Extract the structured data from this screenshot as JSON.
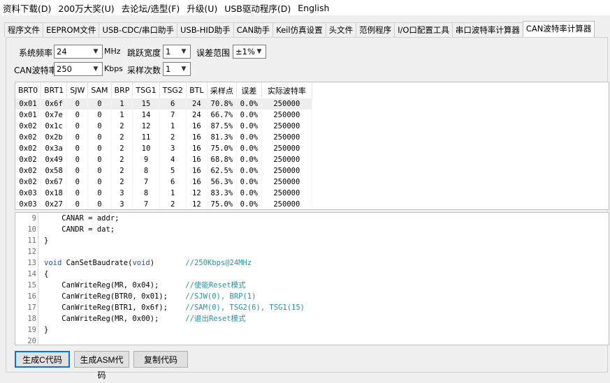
{
  "menu": [
    "资料下载(D)",
    "200万大奖(U)",
    "去论坛/选型(F)",
    "升级(U)",
    "USB驱动程序(D)",
    "English"
  ],
  "tabs": [
    {
      "label": "程序文件"
    },
    {
      "label": "EEPROM文件"
    },
    {
      "label": "USB-CDC/串口助手"
    },
    {
      "label": "USB-HID助手"
    },
    {
      "label": "CAN助手"
    },
    {
      "label": "Keil仿真设置"
    },
    {
      "label": "头文件"
    },
    {
      "label": "范例程序"
    },
    {
      "label": "I/O口配置工具"
    },
    {
      "label": "串口波特率计算器"
    },
    {
      "label": "CAN波特率计算器",
      "active": true
    }
  ],
  "form": {
    "sys_freq_label": "系统频率",
    "sys_freq_value": "24",
    "sys_freq_unit": "MHz",
    "jump_width_label": "跳跃宽度",
    "jump_width_value": "1",
    "error_range_label": "误差范围",
    "error_range_value": "±1%",
    "can_baud_label": "CAN波特率",
    "can_baud_value": "250",
    "can_baud_unit": "Kbps",
    "sample_count_label": "采样次数",
    "sample_count_value": "1"
  },
  "table": {
    "columns": [
      "BRT0",
      "BRT1",
      "SJW",
      "SAM",
      "BRP",
      "TSG1",
      "TSG2",
      "BTL",
      "采样点",
      "误差",
      "实际波特率"
    ],
    "rows": [
      [
        "0x01",
        "0x6f",
        "0",
        "0",
        "1",
        "15",
        "6",
        "24",
        "70.8%",
        "0.0%",
        "250000"
      ],
      [
        "0x01",
        "0x7e",
        "0",
        "0",
        "1",
        "14",
        "7",
        "24",
        "66.7%",
        "0.0%",
        "250000"
      ],
      [
        "0x02",
        "0x1c",
        "0",
        "0",
        "2",
        "12",
        "1",
        "16",
        "87.5%",
        "0.0%",
        "250000"
      ],
      [
        "0x02",
        "0x2b",
        "0",
        "0",
        "2",
        "11",
        "2",
        "16",
        "81.3%",
        "0.0%",
        "250000"
      ],
      [
        "0x02",
        "0x3a",
        "0",
        "0",
        "2",
        "10",
        "3",
        "16",
        "75.0%",
        "0.0%",
        "250000"
      ],
      [
        "0x02",
        "0x49",
        "0",
        "0",
        "2",
        "9",
        "4",
        "16",
        "68.8%",
        "0.0%",
        "250000"
      ],
      [
        "0x02",
        "0x58",
        "0",
        "0",
        "2",
        "8",
        "5",
        "16",
        "62.5%",
        "0.0%",
        "250000"
      ],
      [
        "0x02",
        "0x67",
        "0",
        "0",
        "2",
        "7",
        "6",
        "16",
        "56.3%",
        "0.0%",
        "250000"
      ],
      [
        "0x03",
        "0x18",
        "0",
        "0",
        "3",
        "8",
        "1",
        "12",
        "83.3%",
        "0.0%",
        "250000"
      ],
      [
        "0x03",
        "0x27",
        "0",
        "0",
        "3",
        "7",
        "2",
        "12",
        "75.0%",
        "0.0%",
        "250000"
      ]
    ],
    "selected_row": 0
  },
  "code": [
    {
      "n": "9",
      "parts": [
        {
          "t": "    CANAR = addr;",
          "c": "src"
        }
      ]
    },
    {
      "n": "10",
      "parts": [
        {
          "t": "    CANDR = dat;",
          "c": "src"
        }
      ]
    },
    {
      "n": "11",
      "parts": [
        {
          "t": "}",
          "c": "src"
        }
      ]
    },
    {
      "n": "12",
      "parts": []
    },
    {
      "n": "13",
      "parts": [
        {
          "t": "void",
          "c": "kw"
        },
        {
          "t": " CanSetBaudrate(",
          "c": "src"
        },
        {
          "t": "void",
          "c": "kw"
        },
        {
          "t": ")       ",
          "c": "src"
        },
        {
          "t": "//250Kbps@24MHz",
          "c": "cm"
        }
      ]
    },
    {
      "n": "14",
      "parts": [
        {
          "t": "{",
          "c": "src"
        }
      ]
    },
    {
      "n": "15",
      "parts": [
        {
          "t": "    CanWriteReg(MR, 0x04);      ",
          "c": "src"
        },
        {
          "t": "//使能Reset模式",
          "c": "cm"
        }
      ]
    },
    {
      "n": "16",
      "parts": [
        {
          "t": "    CanWriteReg(BTR0, 0x01);    ",
          "c": "src"
        },
        {
          "t": "//SJW(0), BRP(1)",
          "c": "cm"
        }
      ]
    },
    {
      "n": "17",
      "parts": [
        {
          "t": "    CanWriteReg(BTR1, 0x6f);    ",
          "c": "src"
        },
        {
          "t": "//SAM(0), TSG2(6), TSG1(15)",
          "c": "cm"
        }
      ]
    },
    {
      "n": "18",
      "parts": [
        {
          "t": "    CanWriteReg(MR, 0x00);      ",
          "c": "src"
        },
        {
          "t": "//退出Reset模式",
          "c": "cm"
        }
      ]
    },
    {
      "n": "19",
      "parts": [
        {
          "t": "}",
          "c": "src"
        }
      ]
    },
    {
      "n": "20",
      "parts": []
    }
  ],
  "buttons": {
    "gen_c": "生成C代码",
    "gen_asm": "生成ASM代码",
    "copy": "复制代码"
  }
}
